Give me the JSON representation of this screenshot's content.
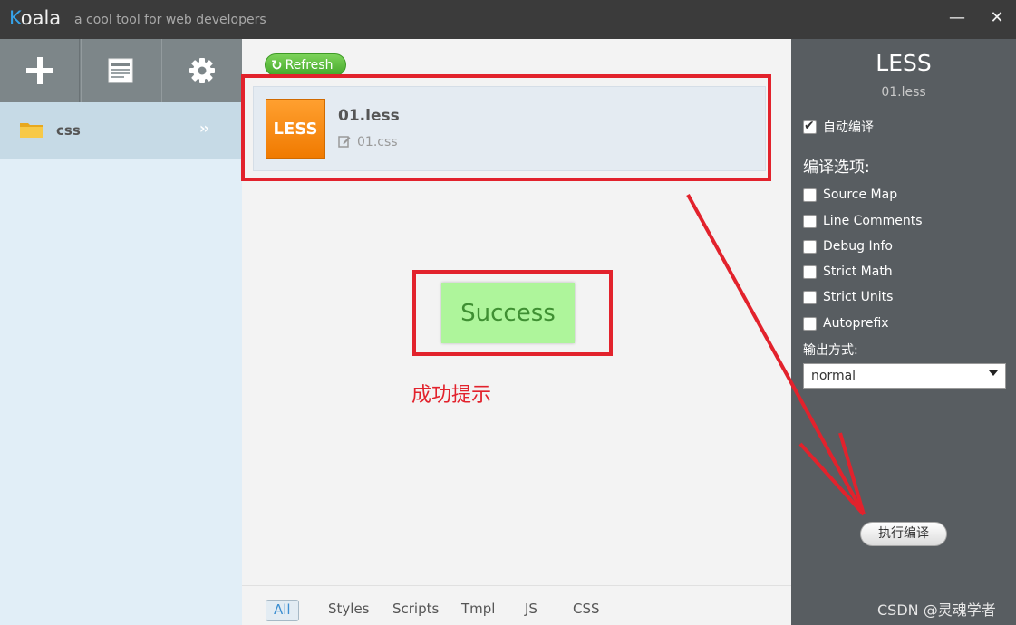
{
  "window": {
    "app_name_first": "K",
    "app_name_rest": "oala",
    "subtitle": "a cool tool for web developers",
    "minimize_glyph": "—",
    "close_glyph": "✕"
  },
  "sidebar": {
    "tools": [
      {
        "icon": "add-icon"
      },
      {
        "icon": "log-icon"
      },
      {
        "icon": "settings-gear-icon"
      }
    ],
    "project": {
      "label": "css",
      "chevron": "»"
    }
  },
  "main": {
    "refresh_label": "Refresh",
    "file": {
      "badge": "LESS",
      "name": "01.less",
      "output": "01.css"
    },
    "success_message": "Success",
    "filters": [
      "All",
      "Styles",
      "Scripts",
      "Tmpl",
      "JS",
      "CSS"
    ],
    "active_filter": "All"
  },
  "settings_panel": {
    "title": "LESS",
    "file": "01.less",
    "auto_compile": {
      "label": "自动编译",
      "checked": true
    },
    "options_heading": "编译选项:",
    "options": [
      {
        "label": "Source Map",
        "checked": false
      },
      {
        "label": "Line Comments",
        "checked": false
      },
      {
        "label": "Debug Info",
        "checked": false
      },
      {
        "label": "Strict Math",
        "checked": false
      },
      {
        "label": "Strict Units",
        "checked": false
      },
      {
        "label": "Autoprefix",
        "checked": false
      }
    ],
    "output_style_label": "输出方式:",
    "output_style_value": "normal",
    "compile_button": "执行编译"
  },
  "annotations": {
    "success_hint": "成功提示",
    "watermark": "CSDN @灵魂学者",
    "color": "#e2222c"
  }
}
